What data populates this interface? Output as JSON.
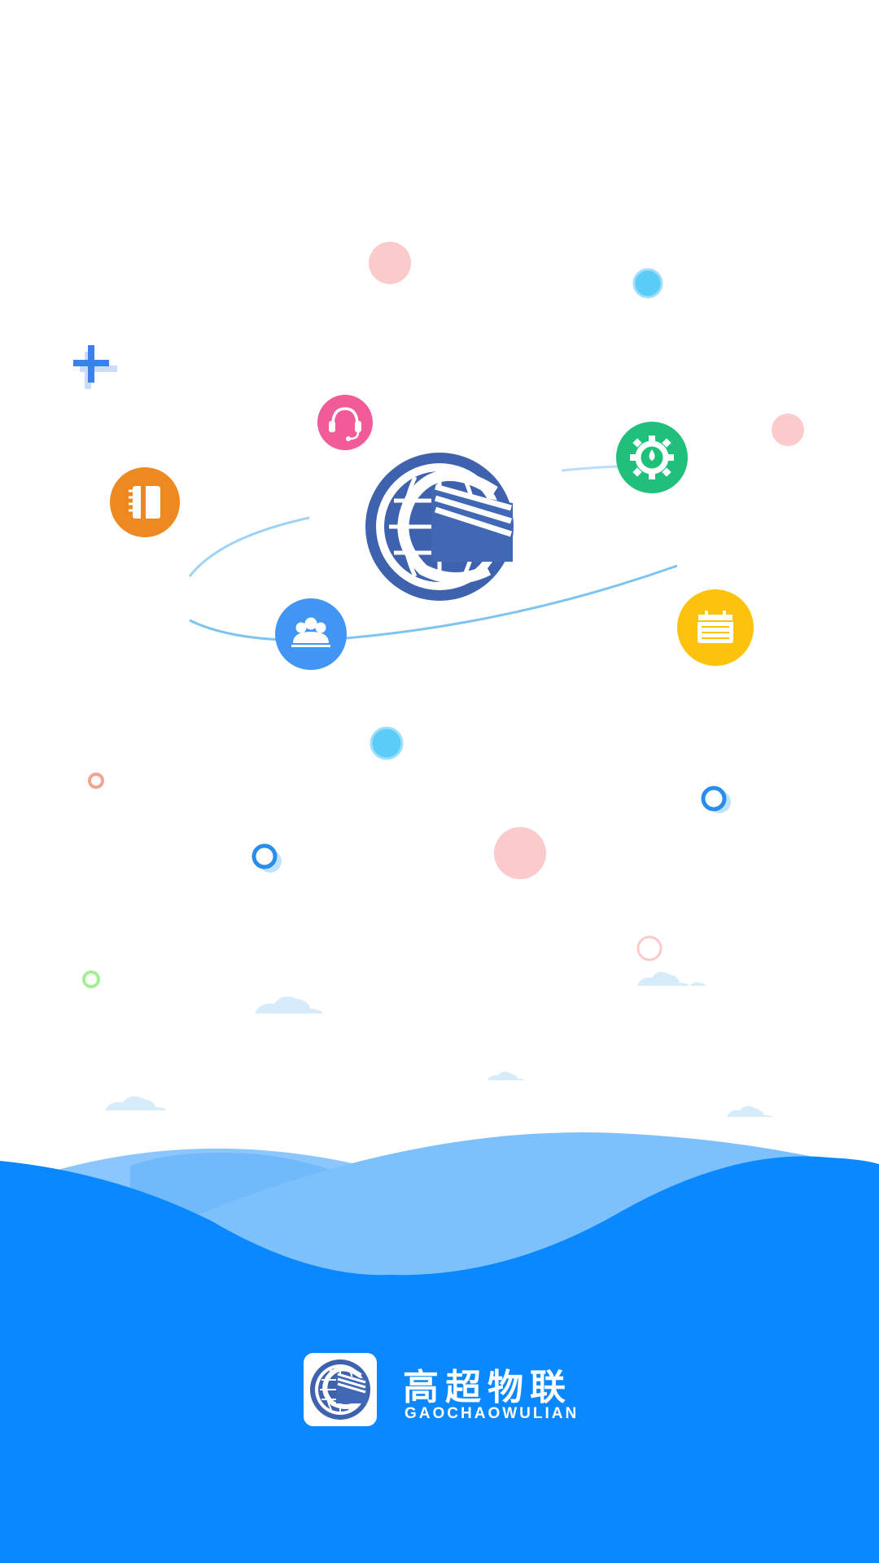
{
  "brand": {
    "name_cn": "高超物联",
    "name_en": "GAOCHAOWULIAN"
  },
  "colors": {
    "primary_blue": "#0A88FF",
    "light_blue": "#7CC1FB",
    "mid_blue": "#48A6FB",
    "logo_blue": "#3E62AE",
    "orange": "#EE8820",
    "pink": "#F15B98",
    "green": "#20C07A",
    "yellow": "#FCC20C",
    "people_blue": "#4196F3",
    "bubble_pink": "#FBCACA",
    "bubble_cyan": "#5BCBF7"
  },
  "icons": [
    "logo-icon",
    "notebook-icon",
    "headset-icon",
    "settings-gear-icon",
    "group-people-icon",
    "calendar-icon",
    "plus-sparkle-icon"
  ]
}
